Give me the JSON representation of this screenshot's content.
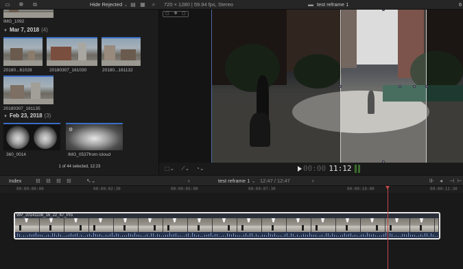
{
  "toolbar": {
    "filter_label": "Hide Rejected",
    "filter_chevron": "⌄",
    "format_info": "720 × 1280 | 59.94 fps, Stereo",
    "project_name": "test reframe 1",
    "zoom_partial": "6"
  },
  "browser": {
    "top_clip_label": "IMG_1092",
    "groups": [
      {
        "date": "Mar 7, 2018",
        "count": "(4)",
        "clips": [
          "20180...61028",
          "20180307_161030",
          "20180...161132",
          "20180307_161135"
        ]
      },
      {
        "date": "Feb 23, 2018",
        "count": "(3)",
        "clips": [
          "360_0014",
          "IMG_0537from icloud"
        ]
      }
    ],
    "status": "1 of 44 selected, 12:23"
  },
  "viewer": {
    "timecode_dim": "00:00",
    "timecode_lit": "11:12",
    "tool_icons": [
      "square-icon",
      "transform-icon",
      "speed-icon"
    ]
  },
  "timeline_bar": {
    "index_label": "Index",
    "project_name": "test reframe 1",
    "project_chevron": "⌄",
    "duration": "12:47 / 12:47"
  },
  "ruler": {
    "ticks": [
      "00:00:00:00",
      "00:00:02:30",
      "00:00:05:00",
      "00:00:07:30",
      "00:00:10:00",
      "00:00:12:30"
    ]
  },
  "timeline": {
    "clip_name": "WP_20141108_16_22_47_Pro"
  }
}
